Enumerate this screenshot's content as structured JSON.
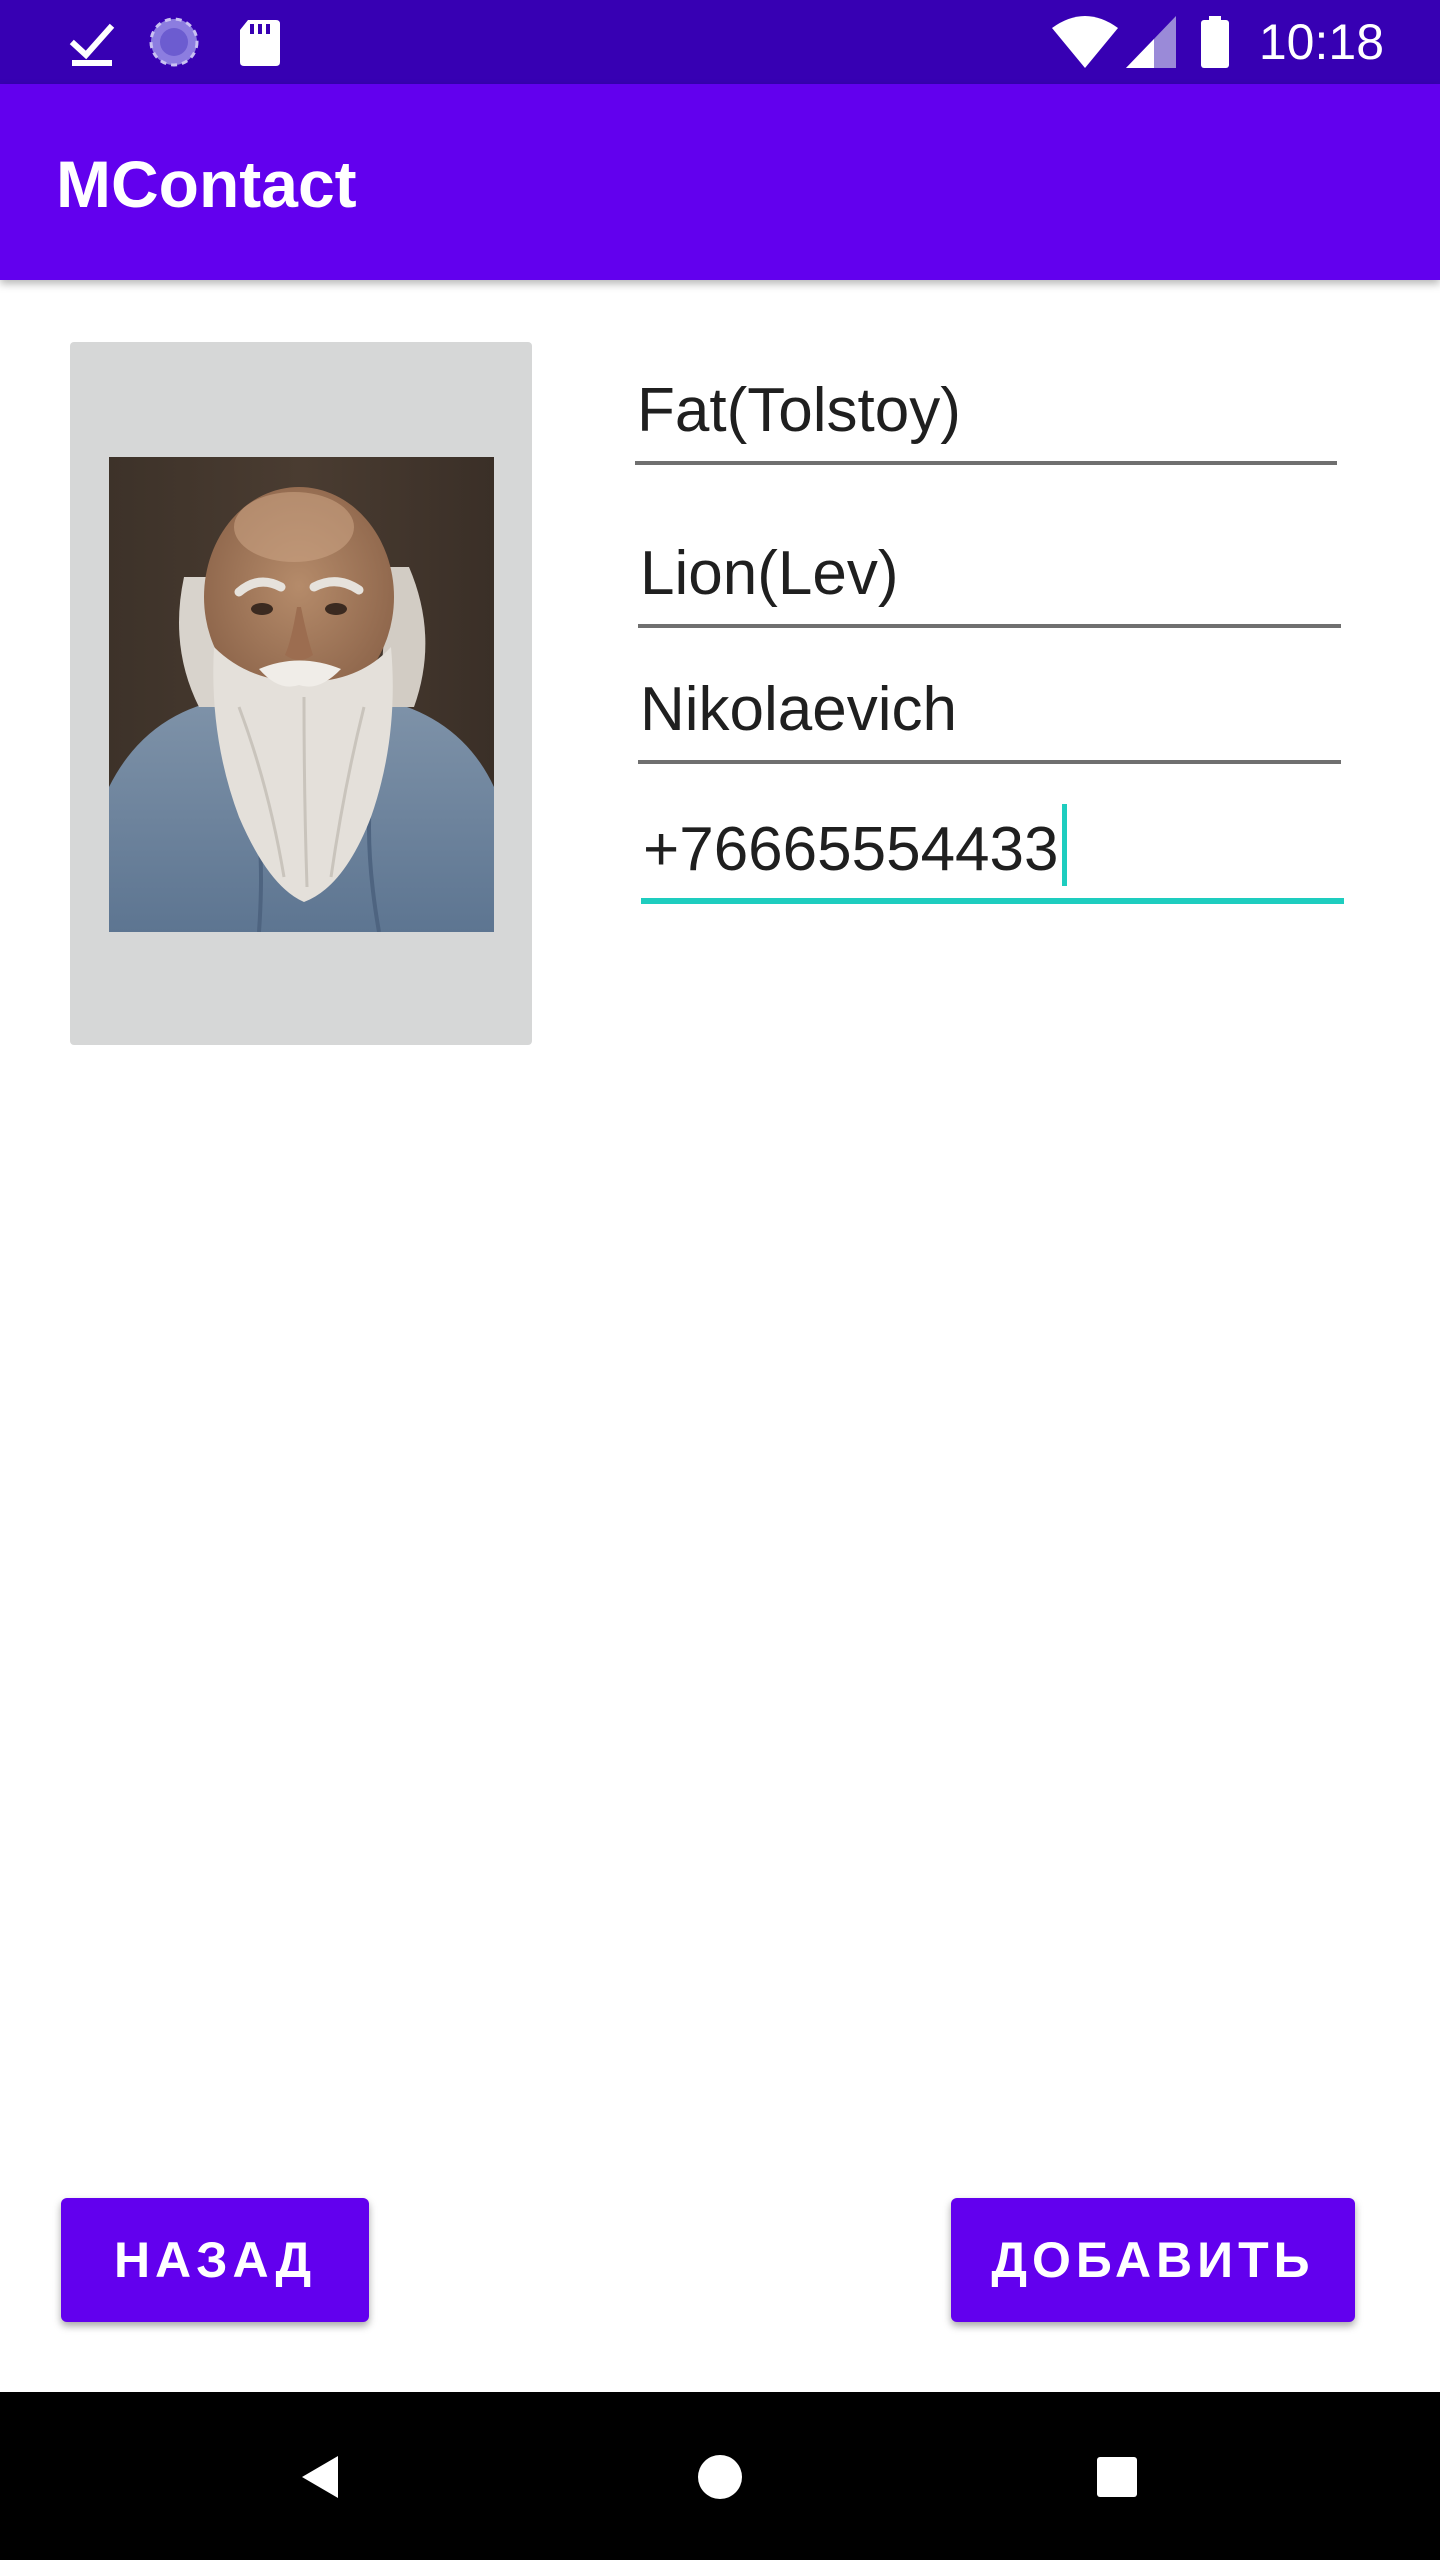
{
  "status_bar": {
    "time": "10:18",
    "icons": [
      "download-done-icon",
      "sync-progress-icon",
      "sd-card-icon",
      "wifi-icon",
      "cellular-signal-icon",
      "battery-icon"
    ]
  },
  "app_bar": {
    "title": "MContact"
  },
  "photo": {
    "description_icon": "portrait-photo"
  },
  "form": {
    "last_name": "Fat(Tolstoy)",
    "first_name": "Lion(Lev)",
    "patronymic": "Nikolaevich",
    "phone": "+76665554433"
  },
  "buttons": {
    "back_label": "НАЗАД",
    "add_label": "ДОБАВИТЬ"
  },
  "navigation": {
    "icons": [
      "back-icon",
      "home-icon",
      "recents-icon"
    ]
  },
  "colors": {
    "status_bar": "#3700b3",
    "primary": "#6200ee",
    "accent": "#1ecdbf",
    "photo_background": "#d6d7d7"
  }
}
